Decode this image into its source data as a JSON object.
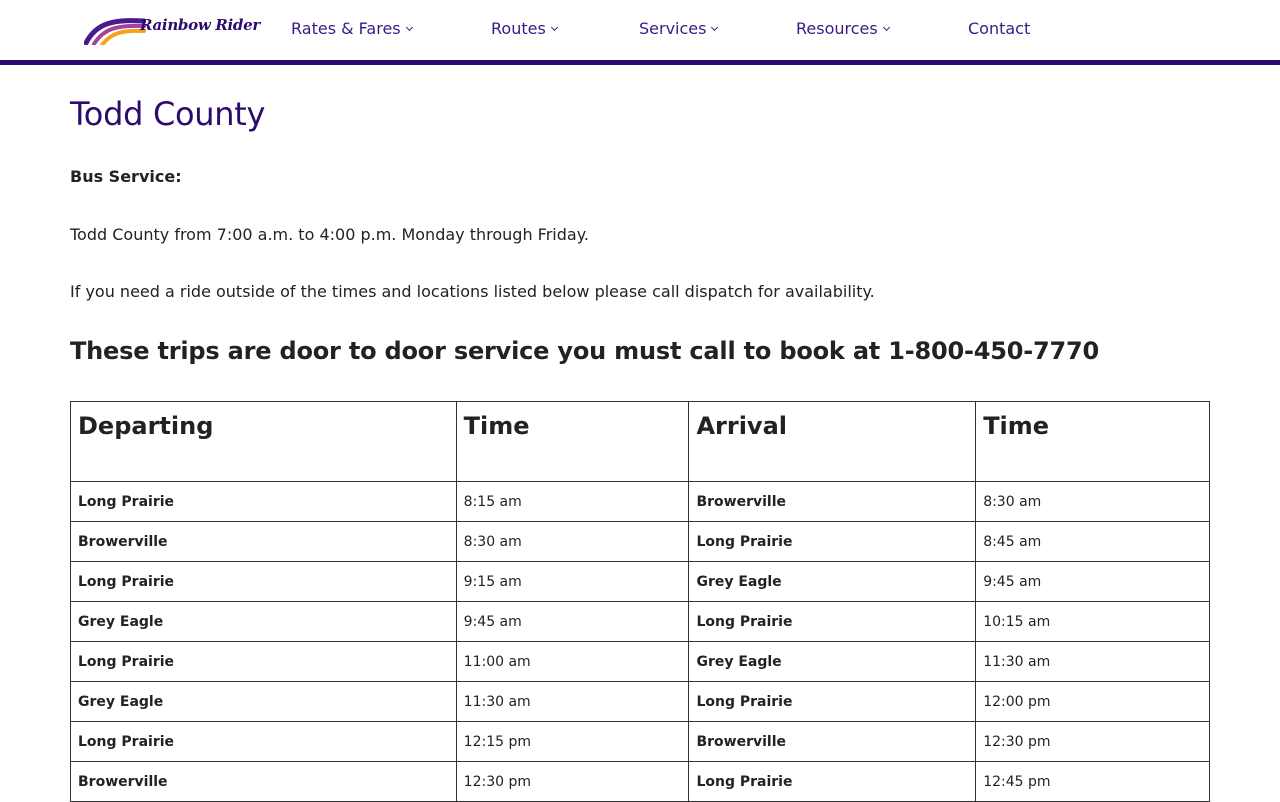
{
  "header": {
    "logo_text": "Rainbow Rider",
    "nav": [
      {
        "label": "Rates & Fares",
        "has_dropdown": true
      },
      {
        "label": "Routes",
        "has_dropdown": true
      },
      {
        "label": "Services",
        "has_dropdown": true
      },
      {
        "label": "Resources",
        "has_dropdown": true
      },
      {
        "label": "Contact",
        "has_dropdown": false
      }
    ]
  },
  "page": {
    "title": "Todd County",
    "bus_service_label": "Bus Service:",
    "hours_text": "Todd County from 7:00 a.m. to 4:00 p.m. Monday through Friday.",
    "note_text": "If you need a ride outside of the times and locations listed below please call dispatch for availability.",
    "subheading": "These trips are door to door service you must call to book at 1-800-450-7770"
  },
  "schedule": {
    "headers": [
      "Departing",
      "Time",
      "Arrival",
      "Time"
    ],
    "rows": [
      [
        "Long Prairie",
        "8:15 am",
        "Browerville",
        "8:30 am"
      ],
      [
        "Browerville",
        "8:30 am",
        "Long Prairie",
        "8:45 am"
      ],
      [
        "Long Prairie",
        "9:15 am",
        "Grey Eagle",
        "9:45 am"
      ],
      [
        "Grey Eagle",
        "9:45 am",
        "Long Prairie",
        "10:15 am"
      ],
      [
        "Long Prairie",
        "11:00 am",
        "Grey Eagle",
        "11:30 am"
      ],
      [
        "Grey Eagle",
        "11:30 am",
        "Long Prairie",
        "12:00 pm"
      ],
      [
        "Long Prairie",
        "12:15 pm",
        "Browerville",
        "12:30 pm"
      ],
      [
        "Browerville",
        "12:30 pm",
        "Long Prairie",
        "12:45 pm"
      ]
    ]
  },
  "colors": {
    "brand_purple": "#2d0a6e",
    "nav_text": "#3b1a86",
    "logo_orange": "#f5a21b"
  }
}
